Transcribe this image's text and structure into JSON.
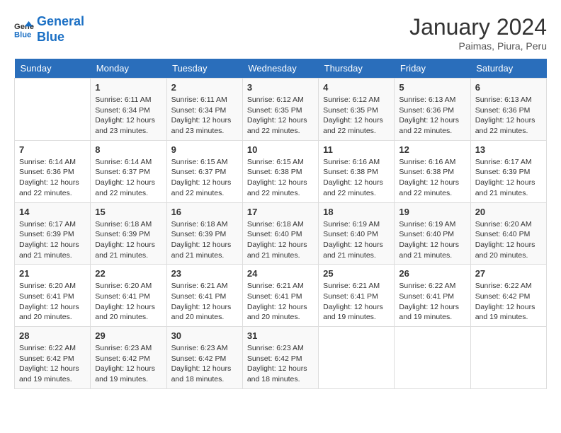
{
  "logo": {
    "line1": "General",
    "line2": "Blue"
  },
  "title": "January 2024",
  "subtitle": "Paimas, Piura, Peru",
  "days_header": [
    "Sunday",
    "Monday",
    "Tuesday",
    "Wednesday",
    "Thursday",
    "Friday",
    "Saturday"
  ],
  "weeks": [
    [
      {
        "day": "",
        "info": ""
      },
      {
        "day": "1",
        "info": "Sunrise: 6:11 AM\nSunset: 6:34 PM\nDaylight: 12 hours\nand 23 minutes."
      },
      {
        "day": "2",
        "info": "Sunrise: 6:11 AM\nSunset: 6:34 PM\nDaylight: 12 hours\nand 23 minutes."
      },
      {
        "day": "3",
        "info": "Sunrise: 6:12 AM\nSunset: 6:35 PM\nDaylight: 12 hours\nand 22 minutes."
      },
      {
        "day": "4",
        "info": "Sunrise: 6:12 AM\nSunset: 6:35 PM\nDaylight: 12 hours\nand 22 minutes."
      },
      {
        "day": "5",
        "info": "Sunrise: 6:13 AM\nSunset: 6:36 PM\nDaylight: 12 hours\nand 22 minutes."
      },
      {
        "day": "6",
        "info": "Sunrise: 6:13 AM\nSunset: 6:36 PM\nDaylight: 12 hours\nand 22 minutes."
      }
    ],
    [
      {
        "day": "7",
        "info": "Sunrise: 6:14 AM\nSunset: 6:36 PM\nDaylight: 12 hours\nand 22 minutes."
      },
      {
        "day": "8",
        "info": "Sunrise: 6:14 AM\nSunset: 6:37 PM\nDaylight: 12 hours\nand 22 minutes."
      },
      {
        "day": "9",
        "info": "Sunrise: 6:15 AM\nSunset: 6:37 PM\nDaylight: 12 hours\nand 22 minutes."
      },
      {
        "day": "10",
        "info": "Sunrise: 6:15 AM\nSunset: 6:38 PM\nDaylight: 12 hours\nand 22 minutes."
      },
      {
        "day": "11",
        "info": "Sunrise: 6:16 AM\nSunset: 6:38 PM\nDaylight: 12 hours\nand 22 minutes."
      },
      {
        "day": "12",
        "info": "Sunrise: 6:16 AM\nSunset: 6:38 PM\nDaylight: 12 hours\nand 22 minutes."
      },
      {
        "day": "13",
        "info": "Sunrise: 6:17 AM\nSunset: 6:39 PM\nDaylight: 12 hours\nand 21 minutes."
      }
    ],
    [
      {
        "day": "14",
        "info": "Sunrise: 6:17 AM\nSunset: 6:39 PM\nDaylight: 12 hours\nand 21 minutes."
      },
      {
        "day": "15",
        "info": "Sunrise: 6:18 AM\nSunset: 6:39 PM\nDaylight: 12 hours\nand 21 minutes."
      },
      {
        "day": "16",
        "info": "Sunrise: 6:18 AM\nSunset: 6:39 PM\nDaylight: 12 hours\nand 21 minutes."
      },
      {
        "day": "17",
        "info": "Sunrise: 6:18 AM\nSunset: 6:40 PM\nDaylight: 12 hours\nand 21 minutes."
      },
      {
        "day": "18",
        "info": "Sunrise: 6:19 AM\nSunset: 6:40 PM\nDaylight: 12 hours\nand 21 minutes."
      },
      {
        "day": "19",
        "info": "Sunrise: 6:19 AM\nSunset: 6:40 PM\nDaylight: 12 hours\nand 21 minutes."
      },
      {
        "day": "20",
        "info": "Sunrise: 6:20 AM\nSunset: 6:40 PM\nDaylight: 12 hours\nand 20 minutes."
      }
    ],
    [
      {
        "day": "21",
        "info": "Sunrise: 6:20 AM\nSunset: 6:41 PM\nDaylight: 12 hours\nand 20 minutes."
      },
      {
        "day": "22",
        "info": "Sunrise: 6:20 AM\nSunset: 6:41 PM\nDaylight: 12 hours\nand 20 minutes."
      },
      {
        "day": "23",
        "info": "Sunrise: 6:21 AM\nSunset: 6:41 PM\nDaylight: 12 hours\nand 20 minutes."
      },
      {
        "day": "24",
        "info": "Sunrise: 6:21 AM\nSunset: 6:41 PM\nDaylight: 12 hours\nand 20 minutes."
      },
      {
        "day": "25",
        "info": "Sunrise: 6:21 AM\nSunset: 6:41 PM\nDaylight: 12 hours\nand 19 minutes."
      },
      {
        "day": "26",
        "info": "Sunrise: 6:22 AM\nSunset: 6:41 PM\nDaylight: 12 hours\nand 19 minutes."
      },
      {
        "day": "27",
        "info": "Sunrise: 6:22 AM\nSunset: 6:42 PM\nDaylight: 12 hours\nand 19 minutes."
      }
    ],
    [
      {
        "day": "28",
        "info": "Sunrise: 6:22 AM\nSunset: 6:42 PM\nDaylight: 12 hours\nand 19 minutes."
      },
      {
        "day": "29",
        "info": "Sunrise: 6:23 AM\nSunset: 6:42 PM\nDaylight: 12 hours\nand 19 minutes."
      },
      {
        "day": "30",
        "info": "Sunrise: 6:23 AM\nSunset: 6:42 PM\nDaylight: 12 hours\nand 18 minutes."
      },
      {
        "day": "31",
        "info": "Sunrise: 6:23 AM\nSunset: 6:42 PM\nDaylight: 12 hours\nand 18 minutes."
      },
      {
        "day": "",
        "info": ""
      },
      {
        "day": "",
        "info": ""
      },
      {
        "day": "",
        "info": ""
      }
    ]
  ]
}
